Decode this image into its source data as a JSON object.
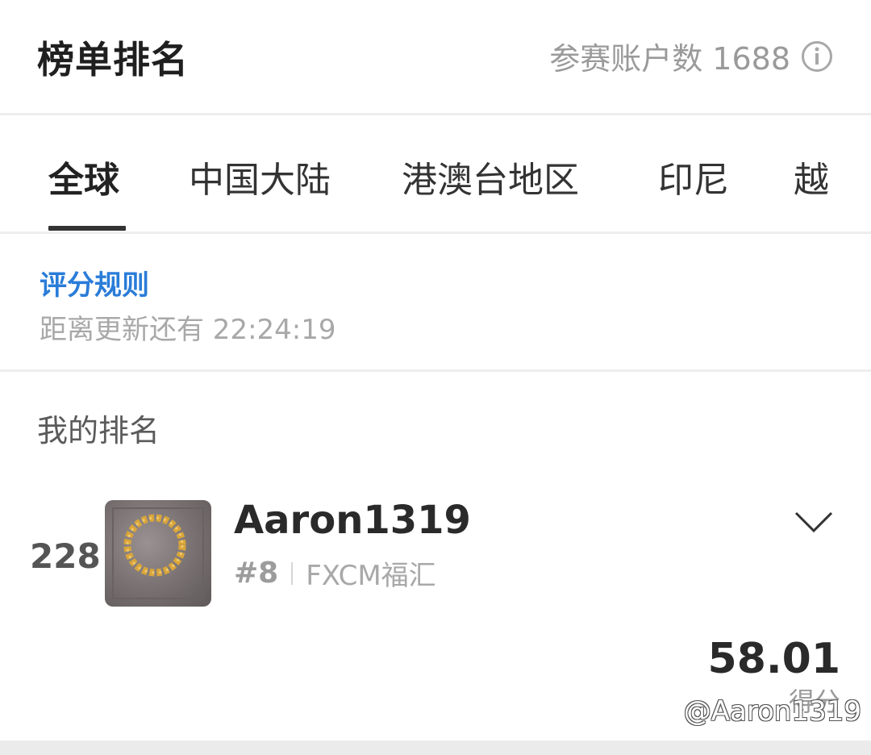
{
  "header": {
    "title": "榜单排名",
    "participants_label": "参赛账户数 1688",
    "info_icon": "info-icon"
  },
  "tabs": [
    {
      "label": "全球",
      "active": true
    },
    {
      "label": "中国大陆"
    },
    {
      "label": "港澳台地区"
    },
    {
      "label": "印尼"
    },
    {
      "label": "越"
    }
  ],
  "rules": {
    "link": "评分规则",
    "countdown": "距离更新还有 22:24:19"
  },
  "my_rank": {
    "label": "我的排名",
    "rank": "228",
    "user_name": "Aaron1319",
    "sub_rank": "#8",
    "broker": "FXCM福汇",
    "score": "58.01",
    "score_label": "得分"
  },
  "watermark": "@Aaron1319",
  "colors": {
    "link": "#2a7cd8",
    "text_dark": "#1f1f1f",
    "text_muted": "#a8a8a8",
    "divider": "#eeeeee"
  }
}
